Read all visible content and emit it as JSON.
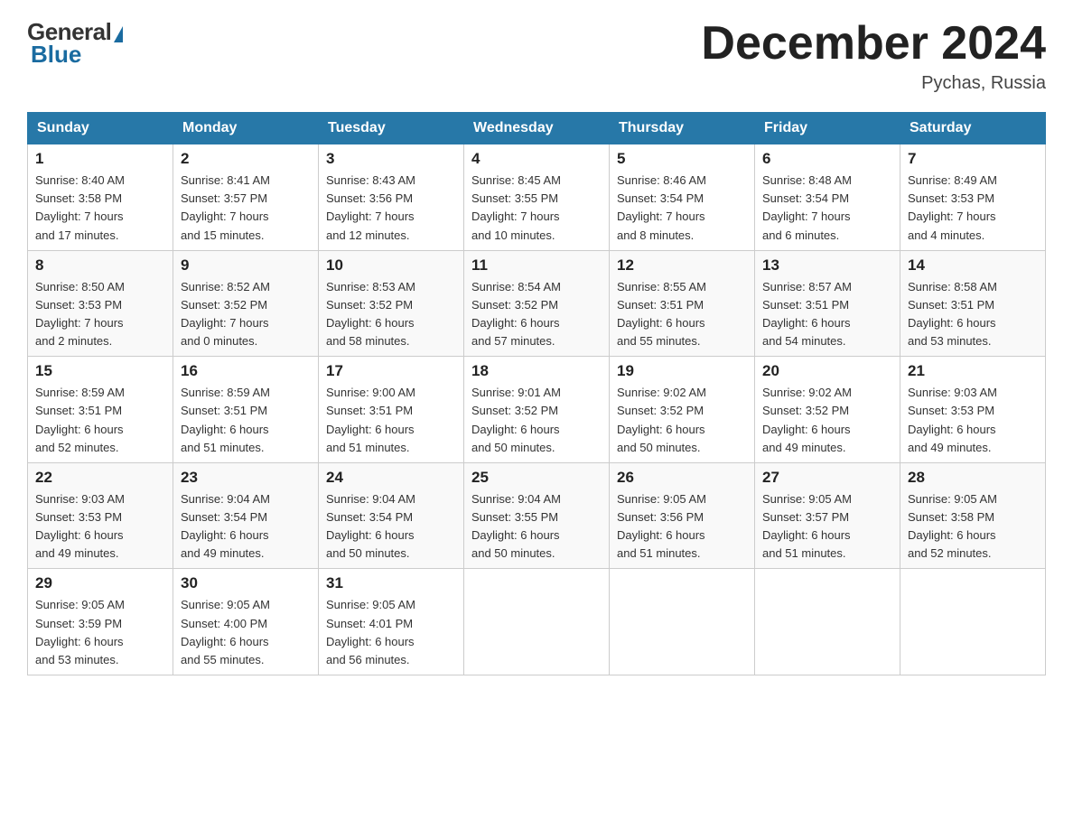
{
  "header": {
    "logo_general": "General",
    "logo_blue": "Blue",
    "month_title": "December 2024",
    "location": "Pychas, Russia"
  },
  "days_of_week": [
    "Sunday",
    "Monday",
    "Tuesday",
    "Wednesday",
    "Thursday",
    "Friday",
    "Saturday"
  ],
  "weeks": [
    [
      {
        "day": "1",
        "info": "Sunrise: 8:40 AM\nSunset: 3:58 PM\nDaylight: 7 hours\nand 17 minutes."
      },
      {
        "day": "2",
        "info": "Sunrise: 8:41 AM\nSunset: 3:57 PM\nDaylight: 7 hours\nand 15 minutes."
      },
      {
        "day": "3",
        "info": "Sunrise: 8:43 AM\nSunset: 3:56 PM\nDaylight: 7 hours\nand 12 minutes."
      },
      {
        "day": "4",
        "info": "Sunrise: 8:45 AM\nSunset: 3:55 PM\nDaylight: 7 hours\nand 10 minutes."
      },
      {
        "day": "5",
        "info": "Sunrise: 8:46 AM\nSunset: 3:54 PM\nDaylight: 7 hours\nand 8 minutes."
      },
      {
        "day": "6",
        "info": "Sunrise: 8:48 AM\nSunset: 3:54 PM\nDaylight: 7 hours\nand 6 minutes."
      },
      {
        "day": "7",
        "info": "Sunrise: 8:49 AM\nSunset: 3:53 PM\nDaylight: 7 hours\nand 4 minutes."
      }
    ],
    [
      {
        "day": "8",
        "info": "Sunrise: 8:50 AM\nSunset: 3:53 PM\nDaylight: 7 hours\nand 2 minutes."
      },
      {
        "day": "9",
        "info": "Sunrise: 8:52 AM\nSunset: 3:52 PM\nDaylight: 7 hours\nand 0 minutes."
      },
      {
        "day": "10",
        "info": "Sunrise: 8:53 AM\nSunset: 3:52 PM\nDaylight: 6 hours\nand 58 minutes."
      },
      {
        "day": "11",
        "info": "Sunrise: 8:54 AM\nSunset: 3:52 PM\nDaylight: 6 hours\nand 57 minutes."
      },
      {
        "day": "12",
        "info": "Sunrise: 8:55 AM\nSunset: 3:51 PM\nDaylight: 6 hours\nand 55 minutes."
      },
      {
        "day": "13",
        "info": "Sunrise: 8:57 AM\nSunset: 3:51 PM\nDaylight: 6 hours\nand 54 minutes."
      },
      {
        "day": "14",
        "info": "Sunrise: 8:58 AM\nSunset: 3:51 PM\nDaylight: 6 hours\nand 53 minutes."
      }
    ],
    [
      {
        "day": "15",
        "info": "Sunrise: 8:59 AM\nSunset: 3:51 PM\nDaylight: 6 hours\nand 52 minutes."
      },
      {
        "day": "16",
        "info": "Sunrise: 8:59 AM\nSunset: 3:51 PM\nDaylight: 6 hours\nand 51 minutes."
      },
      {
        "day": "17",
        "info": "Sunrise: 9:00 AM\nSunset: 3:51 PM\nDaylight: 6 hours\nand 51 minutes."
      },
      {
        "day": "18",
        "info": "Sunrise: 9:01 AM\nSunset: 3:52 PM\nDaylight: 6 hours\nand 50 minutes."
      },
      {
        "day": "19",
        "info": "Sunrise: 9:02 AM\nSunset: 3:52 PM\nDaylight: 6 hours\nand 50 minutes."
      },
      {
        "day": "20",
        "info": "Sunrise: 9:02 AM\nSunset: 3:52 PM\nDaylight: 6 hours\nand 49 minutes."
      },
      {
        "day": "21",
        "info": "Sunrise: 9:03 AM\nSunset: 3:53 PM\nDaylight: 6 hours\nand 49 minutes."
      }
    ],
    [
      {
        "day": "22",
        "info": "Sunrise: 9:03 AM\nSunset: 3:53 PM\nDaylight: 6 hours\nand 49 minutes."
      },
      {
        "day": "23",
        "info": "Sunrise: 9:04 AM\nSunset: 3:54 PM\nDaylight: 6 hours\nand 49 minutes."
      },
      {
        "day": "24",
        "info": "Sunrise: 9:04 AM\nSunset: 3:54 PM\nDaylight: 6 hours\nand 50 minutes."
      },
      {
        "day": "25",
        "info": "Sunrise: 9:04 AM\nSunset: 3:55 PM\nDaylight: 6 hours\nand 50 minutes."
      },
      {
        "day": "26",
        "info": "Sunrise: 9:05 AM\nSunset: 3:56 PM\nDaylight: 6 hours\nand 51 minutes."
      },
      {
        "day": "27",
        "info": "Sunrise: 9:05 AM\nSunset: 3:57 PM\nDaylight: 6 hours\nand 51 minutes."
      },
      {
        "day": "28",
        "info": "Sunrise: 9:05 AM\nSunset: 3:58 PM\nDaylight: 6 hours\nand 52 minutes."
      }
    ],
    [
      {
        "day": "29",
        "info": "Sunrise: 9:05 AM\nSunset: 3:59 PM\nDaylight: 6 hours\nand 53 minutes."
      },
      {
        "day": "30",
        "info": "Sunrise: 9:05 AM\nSunset: 4:00 PM\nDaylight: 6 hours\nand 55 minutes."
      },
      {
        "day": "31",
        "info": "Sunrise: 9:05 AM\nSunset: 4:01 PM\nDaylight: 6 hours\nand 56 minutes."
      },
      {
        "day": "",
        "info": ""
      },
      {
        "day": "",
        "info": ""
      },
      {
        "day": "",
        "info": ""
      },
      {
        "day": "",
        "info": ""
      }
    ]
  ]
}
